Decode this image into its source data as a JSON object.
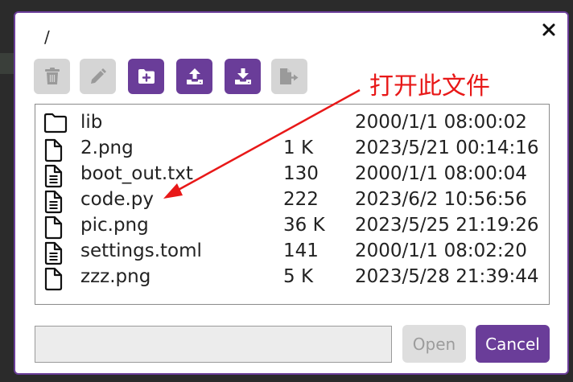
{
  "dialog": {
    "path": "/",
    "close_icon": "close-icon",
    "accent_color": "#6a3d99"
  },
  "toolbar": [
    {
      "name": "delete-button",
      "icon": "trash-icon",
      "enabled": false
    },
    {
      "name": "rename-button",
      "icon": "pencil-icon",
      "enabled": false
    },
    {
      "name": "new-folder-button",
      "icon": "folder-plus-icon",
      "enabled": true
    },
    {
      "name": "upload-button",
      "icon": "upload-icon",
      "enabled": true
    },
    {
      "name": "download-button",
      "icon": "download-icon",
      "enabled": true
    },
    {
      "name": "move-button",
      "icon": "file-export-icon",
      "enabled": false
    }
  ],
  "files": [
    {
      "name": "lib",
      "size": "",
      "date": "2000/1/1 08:00:02",
      "icon": "folder-icon"
    },
    {
      "name": "2.png",
      "size": "1 K",
      "date": "2023/5/21 00:14:16",
      "icon": "file-icon"
    },
    {
      "name": "boot_out.txt",
      "size": "130",
      "date": "2000/1/1 08:00:04",
      "icon": "file-text-icon"
    },
    {
      "name": "code.py",
      "size": "222",
      "date": "2023/6/2 10:56:56",
      "icon": "file-text-icon"
    },
    {
      "name": "pic.png",
      "size": "36 K",
      "date": "2023/5/25 21:19:26",
      "icon": "file-icon"
    },
    {
      "name": "settings.toml",
      "size": "141",
      "date": "2000/1/1 08:02:20",
      "icon": "file-text-icon"
    },
    {
      "name": "zzz.png",
      "size": "5 K",
      "date": "2023/5/28 21:39:44",
      "icon": "file-icon"
    }
  ],
  "footer": {
    "filename_value": "",
    "open_label": "Open",
    "cancel_label": "Cancel"
  },
  "annotation": {
    "text": "打开此文件",
    "color": "#e81818"
  }
}
